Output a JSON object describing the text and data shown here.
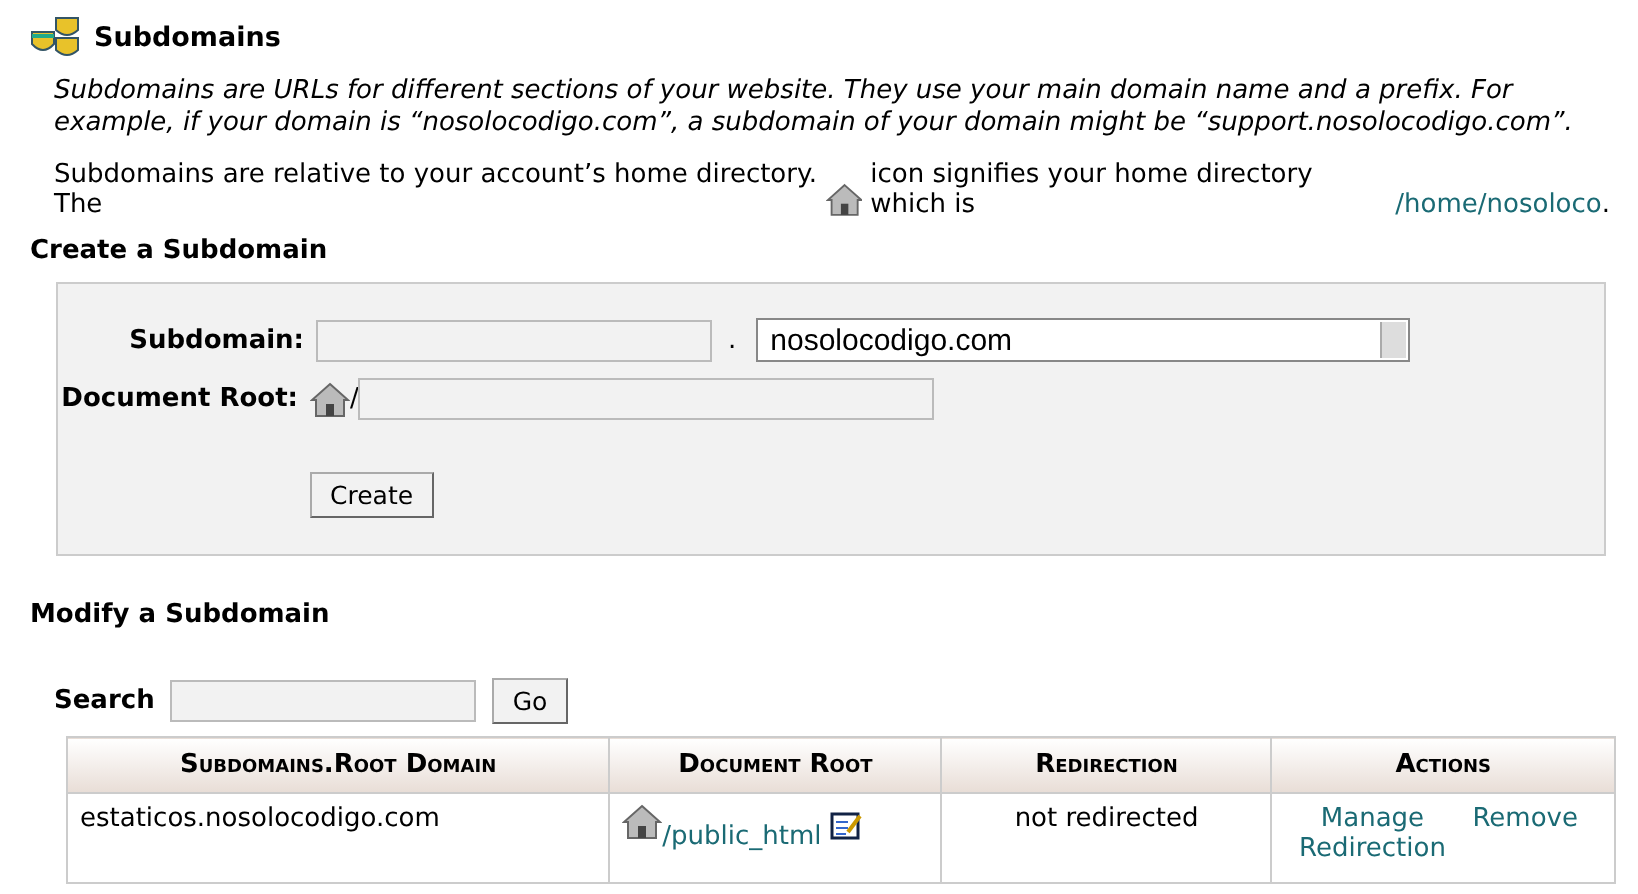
{
  "title": "Subdomains",
  "intro": "Subdomains are URLs for different sections of your website. They use your main domain name and a prefix. For example, if your domain is “nosolocodigo.com”, a subdomain of your domain might be “support.nosolocodigo.com”.",
  "home_note": {
    "before": "Subdomains are relative to your account’s home directory. The",
    "after": "icon signifies your home directory which is",
    "link": "/home/nosoloco",
    "end": "."
  },
  "create": {
    "heading": "Create a Subdomain",
    "subdomain_label": "Subdomain:",
    "dot": ".",
    "domain": "nosolocodigo.com",
    "docroot_label": "Document Root:",
    "slash": "/",
    "button": "Create"
  },
  "modify": {
    "heading": "Modify a Subdomain",
    "search_label": "Search",
    "go": "Go",
    "columns": [
      "Subdomains.Root Domain",
      "Document Root",
      "Redirection",
      "Actions"
    ],
    "rows": [
      {
        "domain": "estaticos.nosolocodigo.com",
        "docroot": "/public_html",
        "redirection": "not redirected",
        "actions": [
          "Manage Redirection",
          "Remove"
        ]
      }
    ]
  }
}
